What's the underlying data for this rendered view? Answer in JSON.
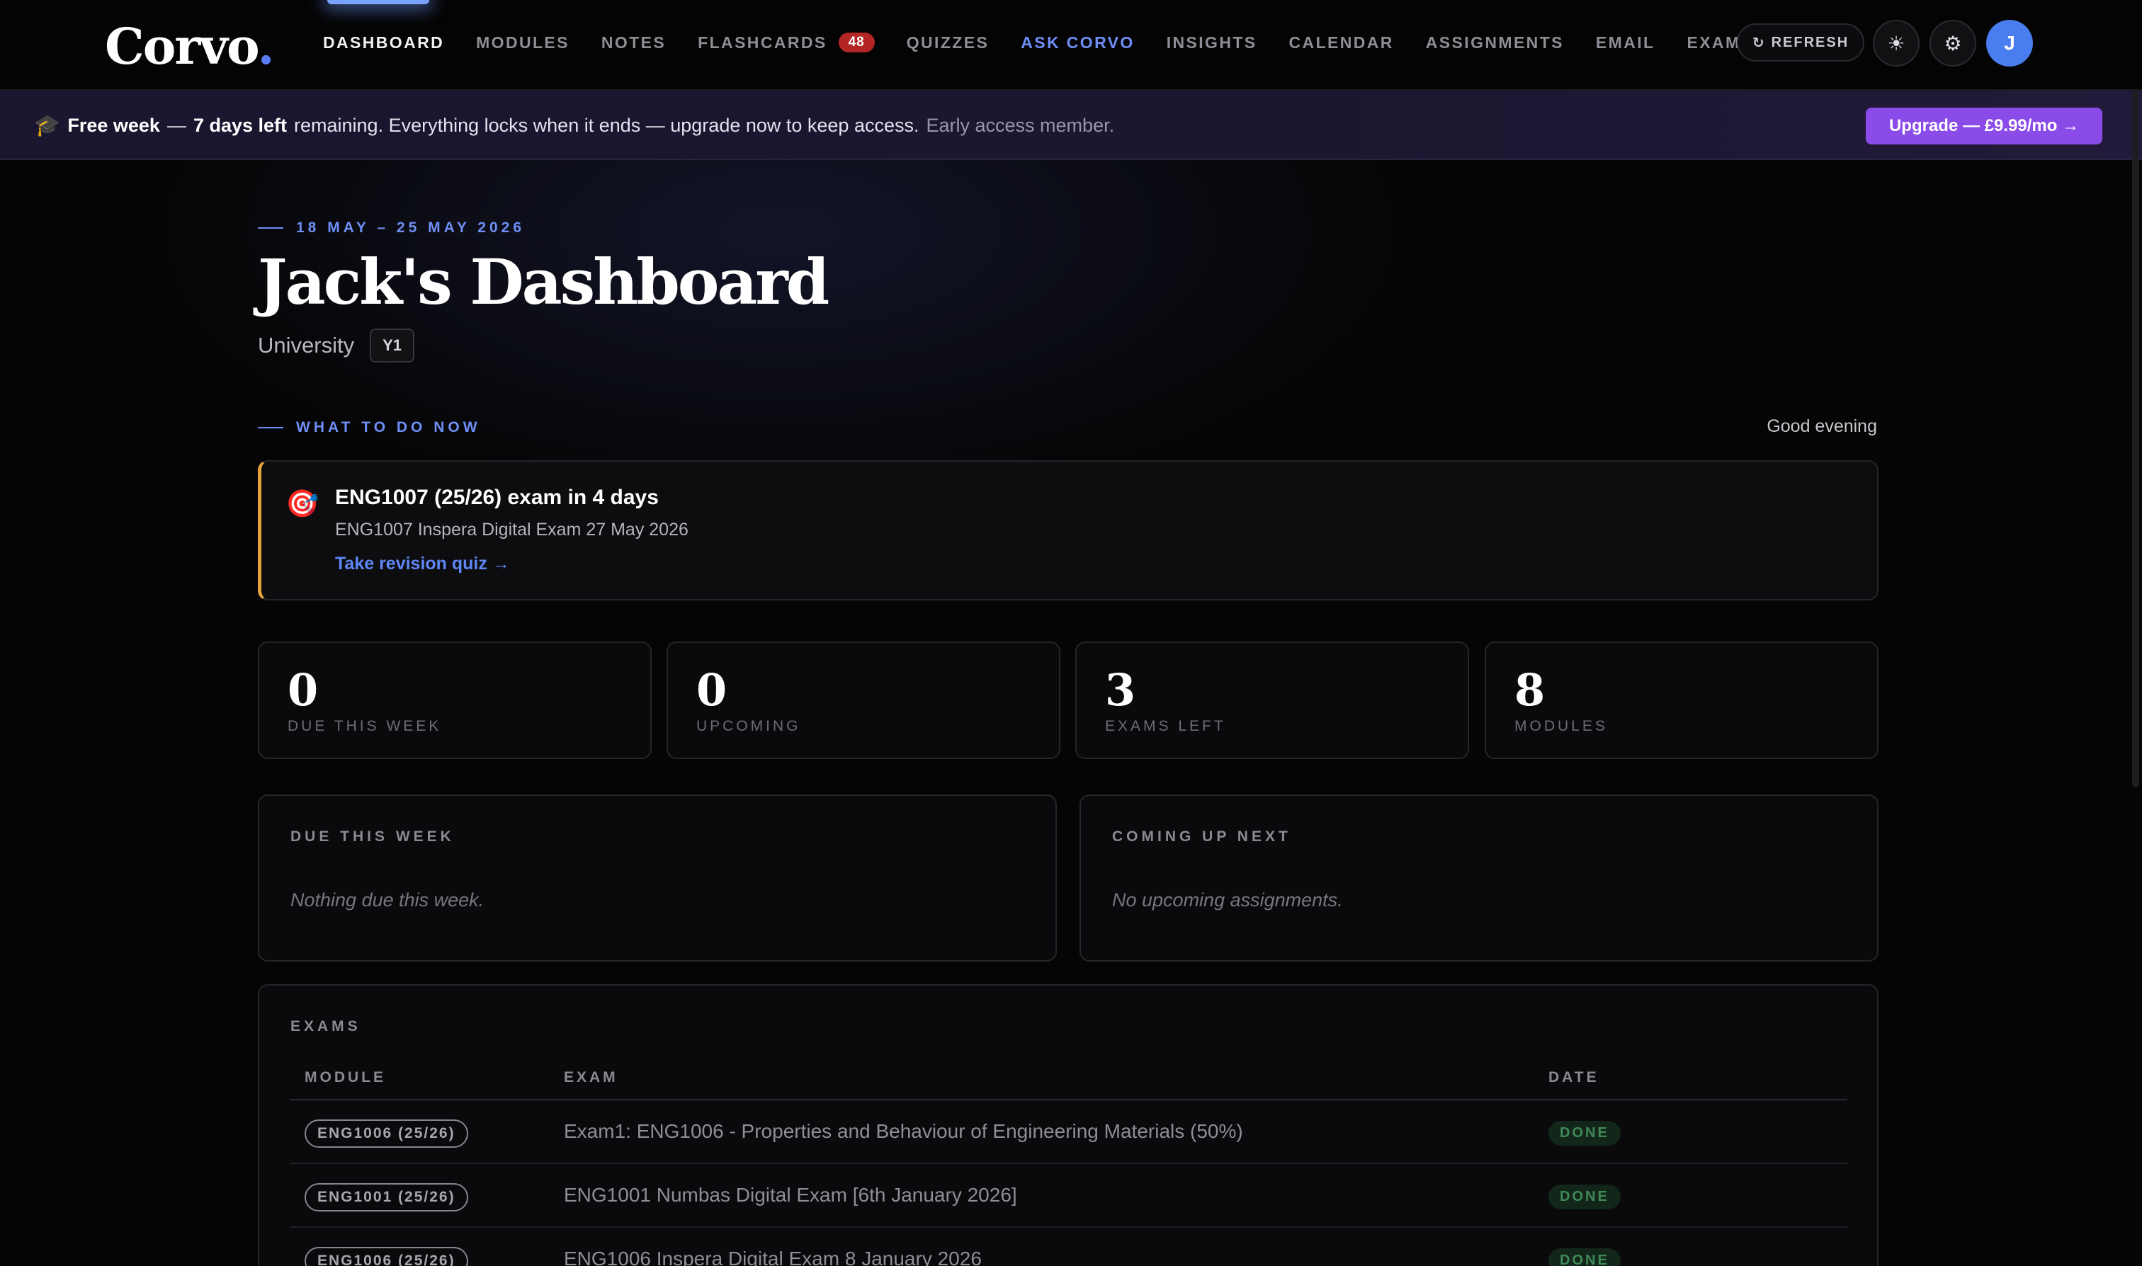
{
  "brand": {
    "name": "Corvo",
    "dot": "."
  },
  "nav": {
    "items": [
      {
        "label": "DASHBOARD"
      },
      {
        "label": "MODULES"
      },
      {
        "label": "NOTES"
      },
      {
        "label": "FLASHCARDS",
        "badge": "48"
      },
      {
        "label": "QUIZZES"
      },
      {
        "label": "ASK CORVO"
      },
      {
        "label": "INSIGHTS"
      },
      {
        "label": "CALENDAR"
      },
      {
        "label": "ASSIGNMENTS"
      },
      {
        "label": "EMAIL"
      },
      {
        "label": "EXAMS"
      }
    ],
    "refresh_label": "REFRESH",
    "refresh_icon": "↻",
    "theme_icon": "☀",
    "settings_icon": "⚙",
    "avatar_initial": "J"
  },
  "banner": {
    "icon": "🎓",
    "highlight": "Free week",
    "dash1": "—",
    "days_left": "7 days left",
    "message": "remaining. Everything locks when it ends — upgrade now to keep access.",
    "member_note": "Early access member.",
    "upgrade_label": "Upgrade — £9.99/mo →"
  },
  "header": {
    "date_range": "18 MAY – 25 MAY 2026",
    "title": "Jack's Dashboard",
    "subtitle": "University",
    "year": "Y1"
  },
  "what_now": {
    "kicker": "WHAT TO DO NOW",
    "greeting": "Good evening",
    "alert": {
      "icon": "🎯",
      "title": "ENG1007 (25/26) exam in 4 days",
      "subtitle": "ENG1007 Inspera Digital Exam 27 May 2026",
      "link": "Take revision quiz →"
    }
  },
  "stats": [
    {
      "value": "0",
      "label": "DUE THIS WEEK"
    },
    {
      "value": "0",
      "label": "UPCOMING"
    },
    {
      "value": "3",
      "label": "EXAMS LEFT"
    },
    {
      "value": "8",
      "label": "MODULES"
    }
  ],
  "panels": {
    "due": {
      "heading": "DUE THIS WEEK",
      "empty": "Nothing due this week."
    },
    "upcoming": {
      "heading": "COMING UP NEXT",
      "empty": "No upcoming assignments."
    }
  },
  "exams": {
    "heading": "EXAMS",
    "columns": {
      "module": "MODULE",
      "exam": "EXAM",
      "date": "DATE"
    },
    "rows": [
      {
        "module": "ENG1006 (25/26)",
        "exam": "Exam1: ENG1006 - Properties and Behaviour of Engineering Materials (50%)",
        "status": "DONE"
      },
      {
        "module": "ENG1001 (25/26)",
        "exam": "ENG1001 Numbas Digital Exam [6th January 2026]",
        "status": "DONE"
      },
      {
        "module": "ENG1006 (25/26)",
        "exam": "ENG1006 Inspera Digital Exam 8 January 2026",
        "status": "DONE"
      }
    ]
  },
  "colors": {
    "accent": "#6f8ff7",
    "upgrade": "#8a4be8",
    "alert_border": "#e6a53a",
    "badge_red": "#b42525",
    "done_green": "#3f8a57"
  }
}
